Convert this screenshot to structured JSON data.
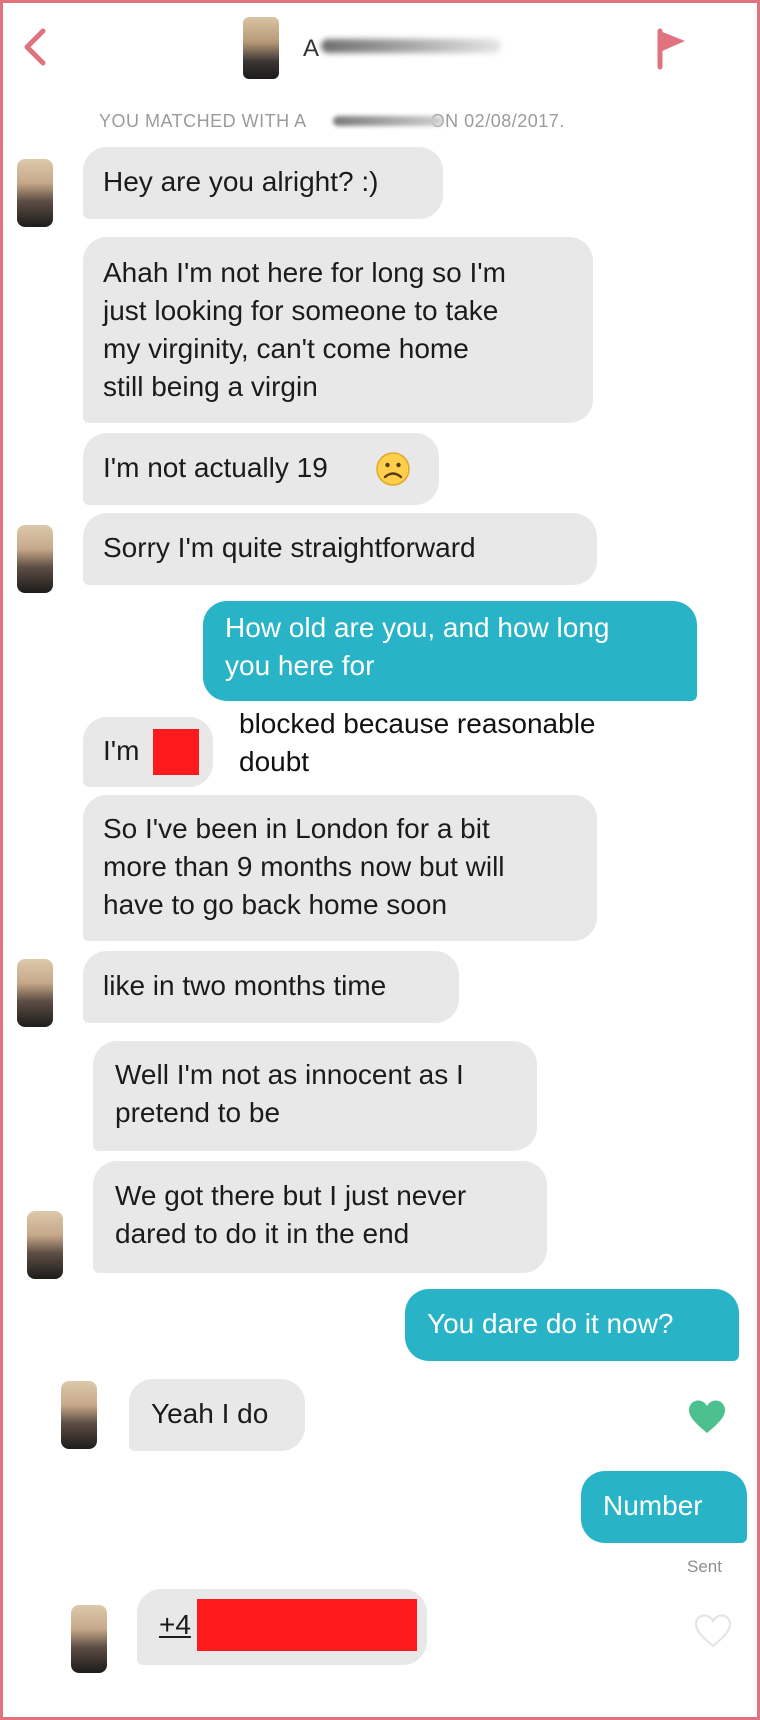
{
  "header": {
    "back_icon": "chevron-left-icon",
    "name": "A",
    "flag_icon": "flag-icon"
  },
  "match_banner": {
    "prefix": "YOU MATCHED WITH A",
    "suffix": "ON 02/08/2017."
  },
  "messages": [
    {
      "from": "them",
      "text": "Hey are you alright? :)"
    },
    {
      "from": "them",
      "text": "Ahah I'm not here for long so I'm\njust looking for someone to take\nmy virginity, can't come home\nstill being a virgin"
    },
    {
      "from": "them",
      "text": "I'm not actually 19",
      "emoji": "frowning-face-icon"
    },
    {
      "from": "them",
      "text": "Sorry I'm quite straightforward"
    },
    {
      "from": "me",
      "text": "How old are you, and how long\nyou here for"
    },
    {
      "from": "them",
      "text": "I'm",
      "redacted": true
    },
    {
      "from": "them",
      "text": "So I've been in London for a bit\nmore than 9 months now but will\nhave to go back home soon"
    },
    {
      "from": "them",
      "text": "like in two months time"
    },
    {
      "from": "them",
      "text": "Well I'm not as innocent as I\npretend to be"
    },
    {
      "from": "them",
      "text": "We got there but I just never\ndared to do it in the end"
    },
    {
      "from": "me",
      "text": "You dare do it now?"
    },
    {
      "from": "them",
      "text": "Yeah I do"
    },
    {
      "from": "me",
      "text": "Number",
      "status": "Sent"
    },
    {
      "from": "them",
      "text": "+4",
      "redacted": true
    }
  ],
  "annotation": "blocked because reasonable\ndoubt",
  "colors": {
    "accent_pink": "#e0737e",
    "outgoing_bubble": "#29b3c6",
    "incoming_bubble": "#e8e8e8",
    "like_heart": "#4cc18f",
    "redaction": "#ff1b1b"
  },
  "icons": {
    "liked": "heart-filled-icon",
    "not_liked": "heart-outline-icon"
  }
}
